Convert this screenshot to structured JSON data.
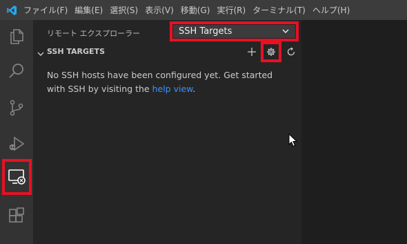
{
  "titlebar": {
    "menu": [
      "ファイル(F)",
      "編集(E)",
      "選択(S)",
      "表示(V)",
      "移動(G)",
      "実行(R)",
      "ターミナル(T)",
      "ヘルプ(H)"
    ]
  },
  "sidebar": {
    "title": "リモート エクスプローラー",
    "dropdown_value": "SSH Targets",
    "section_title": "SSH TARGETS",
    "message_text": "No SSH hosts have been configured yet. Get started with SSH by visiting the ",
    "message_link": "help view",
    "message_end": "."
  },
  "colors": {
    "highlight": "#e81123",
    "link": "#3794ff",
    "activitybar": "#333333",
    "sidebar": "#252526",
    "titlebar": "#3c3c3c"
  }
}
